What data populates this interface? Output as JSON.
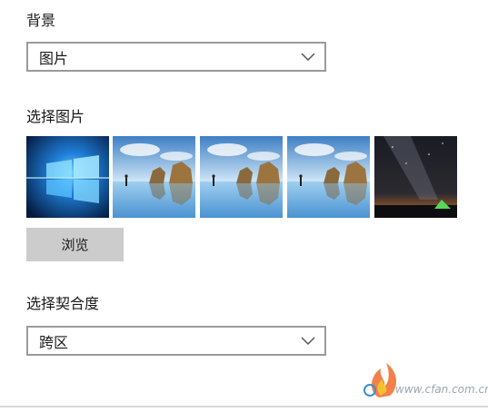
{
  "background": {
    "label": "背景",
    "selected": "图片"
  },
  "picture": {
    "label": "选择图片",
    "thumbnails": [
      {
        "name": "windows-10-hero"
      },
      {
        "name": "beach-rocks-runner"
      },
      {
        "name": "beach-rocks-runner"
      },
      {
        "name": "beach-rocks-runner"
      },
      {
        "name": "milky-way-tent"
      }
    ],
    "browse_label": "浏览"
  },
  "fit": {
    "label": "选择契合度",
    "selected": "跨区"
  },
  "watermark": {
    "text": "www.cfan.com.cn"
  }
}
